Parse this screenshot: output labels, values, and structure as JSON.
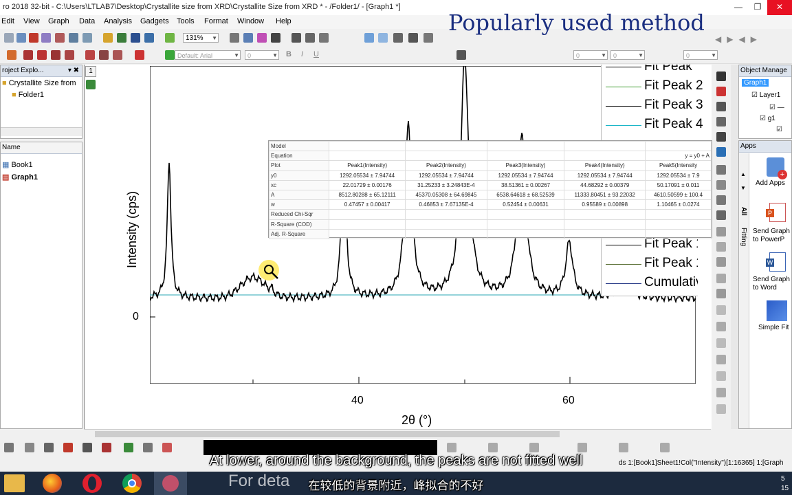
{
  "window": {
    "title": "ro 2018 32-bit - C:\\Users\\LTLAB7\\Desktop\\Crystallite size from XRD\\Crystallite Size from XRD * - /Folder1/ - [Graph1 *]",
    "minimize": "—",
    "restore": "❐",
    "close": "✕"
  },
  "overlay_title": "Popularly used method",
  "menu": [
    "Edit",
    "View",
    "Graph",
    "Data",
    "Analysis",
    "Gadgets",
    "Tools",
    "Format",
    "Window",
    "Help"
  ],
  "toolbar": {
    "zoom": "131%",
    "font": "Default: Arial",
    "font_size": "0",
    "size2": "0",
    "size3": "0",
    "size4": "0"
  },
  "project_explorer": {
    "title": "roject Explo...",
    "root": "Crystallite Size from",
    "folder": "Folder1",
    "name_col": "Name",
    "items": [
      "Book1",
      "Graph1"
    ]
  },
  "layer_tab": "1",
  "graph": {
    "ylabel": "Intensity (cps)",
    "xlabel": "2θ (°)",
    "y_tick": "0",
    "x_ticks": [
      "40",
      "60"
    ]
  },
  "legend": {
    "top": [
      "Fit Peak",
      "Fit Peak 2",
      "Fit Peak 3",
      "Fit Peak 4"
    ],
    "bottom": [
      "Fit Peak 1",
      "Fit Peak 1",
      "Cumulativ"
    ],
    "colors": [
      "#000000",
      "#3a9a2a",
      "#000000",
      "#1ab6c8",
      "#000000",
      "#556b2f",
      "#2c3e8a"
    ]
  },
  "results": {
    "rows": [
      {
        "label": "Model",
        "values": [
          "",
          "",
          "",
          "",
          ""
        ]
      },
      {
        "label": "Equation",
        "values": [
          "",
          "",
          "",
          "",
          "y = y0 + A"
        ]
      },
      {
        "label": "Plot",
        "values": [
          "Peak1(Intensity)",
          "Peak2(Intensity)",
          "Peak3(Intensity)",
          "Peak4(Intensity)",
          "Peak5(Intensity"
        ]
      },
      {
        "label": "y0",
        "values": [
          "1292.05534 ± 7.94744",
          "1292.05534 ± 7.94744",
          "1292.05534 ± 7.94744",
          "1292.05534 ± 7.94744",
          "1292.05534 ± 7.9"
        ]
      },
      {
        "label": "xc",
        "values": [
          "22.01729 ± 0.00176",
          "31.25233 ± 3.24843E-4",
          "38.51361 ± 0.00267",
          "44.68292 ± 0.00379",
          "50.17091 ± 0.011"
        ]
      },
      {
        "label": "A",
        "values": [
          "8512.80288 ± 65.12111",
          "45370.05308 ± 64.69845",
          "6538.64618 ± 68.52539",
          "11333.80451 ± 93.22032",
          "4610.50599 ± 100.4"
        ]
      },
      {
        "label": "w",
        "values": [
          "0.47457 ± 0.00417",
          "0.46853 ± 7.67135E-4",
          "0.52454 ± 0.00631",
          "0.95589 ± 0.00898",
          "1.10465 ± 0.0274"
        ]
      },
      {
        "label": "Reduced Chi-Sqr",
        "values": [
          "",
          "",
          "",
          "",
          ""
        ]
      },
      {
        "label": "R-Square (COD)",
        "values": [
          "",
          "",
          "",
          "",
          ""
        ]
      },
      {
        "label": "Adj. R-Square",
        "values": [
          "",
          "",
          "",
          "",
          ""
        ]
      }
    ]
  },
  "object_manager": {
    "title": "Object Manage",
    "items": [
      "Graph1",
      "Layer1",
      "g1"
    ]
  },
  "apps": {
    "title": "Apps",
    "side_tabs": [
      "All",
      "Fitting"
    ],
    "items": [
      {
        "label": "Add Apps",
        "icon": "add-apps-icon"
      },
      {
        "label": "Send Graph to PowerP",
        "icon": "powerpoint-icon"
      },
      {
        "label": "Send Graph to Word",
        "icon": "word-icon"
      },
      {
        "label": "Simple Fit",
        "icon": "simple-fit-icon"
      }
    ]
  },
  "status": {
    "text": "ds  1:[Book1]Sheet1!Col(\"Intensity\")[1:16365]  1:[Graph"
  },
  "subtitles": {
    "en": "At lower, around the background, the peaks are not fitted well",
    "zh": "在较低的背景附近，峰拟合的不好",
    "ghost": "For deta"
  },
  "taskbar": {
    "apps": [
      "file-explorer-icon",
      "firefox-icon",
      "opera-icon",
      "chrome-icon",
      "origin-icon"
    ],
    "clock": "5\n15"
  }
}
